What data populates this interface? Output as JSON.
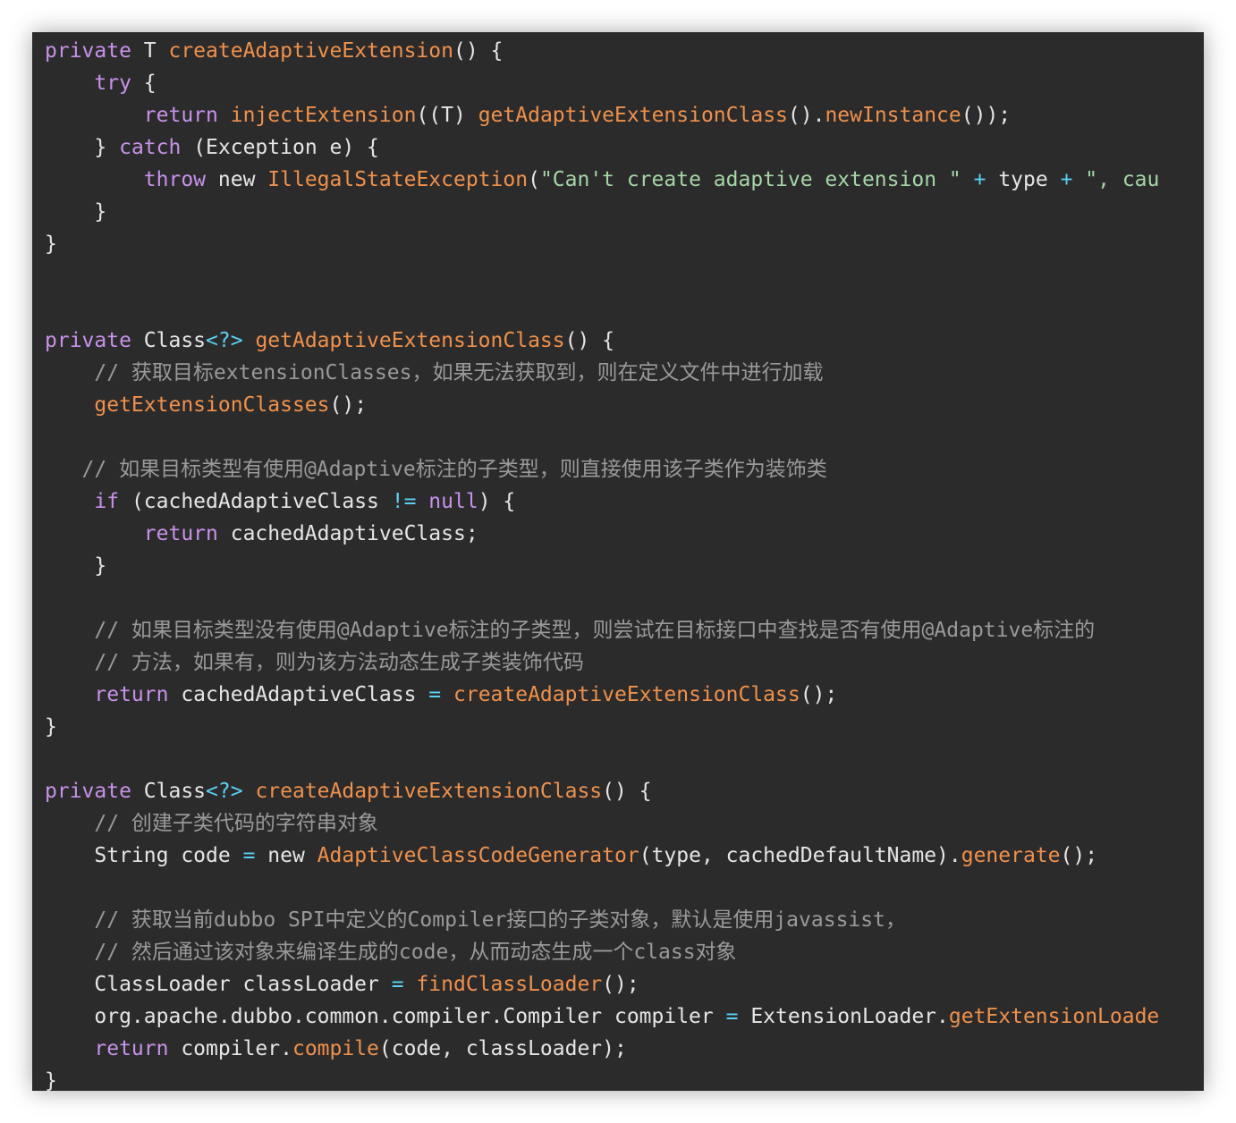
{
  "colors": {
    "background": "#2b2b2b",
    "keyword": "#c792ea",
    "function": "#f0914b",
    "string": "#a5d6a7",
    "operator": "#59d2f5",
    "comment": "#9a9a9a",
    "plain": "#e6e6e6"
  },
  "code_lines": [
    [
      [
        "kw",
        "private"
      ],
      [
        "pl",
        " T "
      ],
      [
        "fn",
        "createAdaptiveExtension"
      ],
      [
        "pl",
        "() {"
      ]
    ],
    [
      [
        "pl",
        "    "
      ],
      [
        "kw",
        "try"
      ],
      [
        "pl",
        " {"
      ]
    ],
    [
      [
        "pl",
        "        "
      ],
      [
        "kw",
        "return"
      ],
      [
        "pl",
        " "
      ],
      [
        "fn",
        "injectExtension"
      ],
      [
        "pl",
        "((T) "
      ],
      [
        "fn",
        "getAdaptiveExtensionClass"
      ],
      [
        "pl",
        "()."
      ],
      [
        "fn",
        "newInstance"
      ],
      [
        "pl",
        "());"
      ]
    ],
    [
      [
        "pl",
        "    } "
      ],
      [
        "kw",
        "catch"
      ],
      [
        "pl",
        " (Exception e) {"
      ]
    ],
    [
      [
        "pl",
        "        "
      ],
      [
        "kw",
        "throw"
      ],
      [
        "pl",
        " new "
      ],
      [
        "fn",
        "IllegalStateException"
      ],
      [
        "pl",
        "("
      ],
      [
        "str",
        "\"Can't create adaptive extension \""
      ],
      [
        "pl",
        " "
      ],
      [
        "op",
        "+"
      ],
      [
        "pl",
        " type "
      ],
      [
        "op",
        "+"
      ],
      [
        "pl",
        " "
      ],
      [
        "str",
        "\", cau"
      ]
    ],
    [
      [
        "pl",
        "    }"
      ]
    ],
    [
      [
        "pl",
        "}"
      ]
    ],
    [],
    [],
    [
      [
        "kw",
        "private"
      ],
      [
        "pl",
        " Class"
      ],
      [
        "op",
        "<?>"
      ],
      [
        "pl",
        " "
      ],
      [
        "fn",
        "getAdaptiveExtensionClass"
      ],
      [
        "pl",
        "() {"
      ]
    ],
    [
      [
        "pl",
        "    "
      ],
      [
        "cm",
        "// 获取目标extensionClasses，如果无法获取到，则在定义文件中进行加载"
      ]
    ],
    [
      [
        "pl",
        "    "
      ],
      [
        "fn",
        "getExtensionClasses"
      ],
      [
        "pl",
        "();"
      ]
    ],
    [],
    [
      [
        "pl",
        "   "
      ],
      [
        "cm",
        "// 如果目标类型有使用@Adaptive标注的子类型，则直接使用该子类作为装饰类"
      ]
    ],
    [
      [
        "pl",
        "    "
      ],
      [
        "kw",
        "if"
      ],
      [
        "pl",
        " (cachedAdaptiveClass "
      ],
      [
        "op",
        "!="
      ],
      [
        "pl",
        " "
      ],
      [
        "kw",
        "null"
      ],
      [
        "pl",
        ") {"
      ]
    ],
    [
      [
        "pl",
        "        "
      ],
      [
        "kw",
        "return"
      ],
      [
        "pl",
        " cachedAdaptiveClass;"
      ]
    ],
    [
      [
        "pl",
        "    }"
      ]
    ],
    [],
    [
      [
        "pl",
        "    "
      ],
      [
        "cm",
        "// 如果目标类型没有使用@Adaptive标注的子类型，则尝试在目标接口中查找是否有使用@Adaptive标注的"
      ]
    ],
    [
      [
        "pl",
        "    "
      ],
      [
        "cm",
        "// 方法，如果有，则为该方法动态生成子类装饰代码"
      ]
    ],
    [
      [
        "pl",
        "    "
      ],
      [
        "kw",
        "return"
      ],
      [
        "pl",
        " cachedAdaptiveClass "
      ],
      [
        "op",
        "="
      ],
      [
        "pl",
        " "
      ],
      [
        "fn",
        "createAdaptiveExtensionClass"
      ],
      [
        "pl",
        "();"
      ]
    ],
    [
      [
        "pl",
        "}"
      ]
    ],
    [],
    [
      [
        "kw",
        "private"
      ],
      [
        "pl",
        " Class"
      ],
      [
        "op",
        "<?>"
      ],
      [
        "pl",
        " "
      ],
      [
        "fn",
        "createAdaptiveExtensionClass"
      ],
      [
        "pl",
        "() {"
      ]
    ],
    [
      [
        "pl",
        "    "
      ],
      [
        "cm",
        "// 创建子类代码的字符串对象"
      ]
    ],
    [
      [
        "pl",
        "    String code "
      ],
      [
        "op",
        "="
      ],
      [
        "pl",
        " new "
      ],
      [
        "fn",
        "AdaptiveClassCodeGenerator"
      ],
      [
        "pl",
        "(type, cachedDefaultName)."
      ],
      [
        "fn",
        "generate"
      ],
      [
        "pl",
        "();"
      ]
    ],
    [],
    [
      [
        "pl",
        "    "
      ],
      [
        "cm",
        "// 获取当前dubbo SPI中定义的Compiler接口的子类对象，默认是使用javassist，"
      ]
    ],
    [
      [
        "pl",
        "    "
      ],
      [
        "cm",
        "// 然后通过该对象来编译生成的code，从而动态生成一个class对象"
      ]
    ],
    [
      [
        "pl",
        "    ClassLoader classLoader "
      ],
      [
        "op",
        "="
      ],
      [
        "pl",
        " "
      ],
      [
        "fn",
        "findClassLoader"
      ],
      [
        "pl",
        "();"
      ]
    ],
    [
      [
        "pl",
        "    org.apache.dubbo.common.compiler.Compiler compiler "
      ],
      [
        "op",
        "="
      ],
      [
        "pl",
        " ExtensionLoader."
      ],
      [
        "fn",
        "getExtensionLoade"
      ]
    ],
    [
      [
        "pl",
        "    "
      ],
      [
        "kw",
        "return"
      ],
      [
        "pl",
        " compiler."
      ],
      [
        "fn",
        "compile"
      ],
      [
        "pl",
        "(code, classLoader);"
      ]
    ],
    [
      [
        "pl",
        "}"
      ]
    ]
  ]
}
